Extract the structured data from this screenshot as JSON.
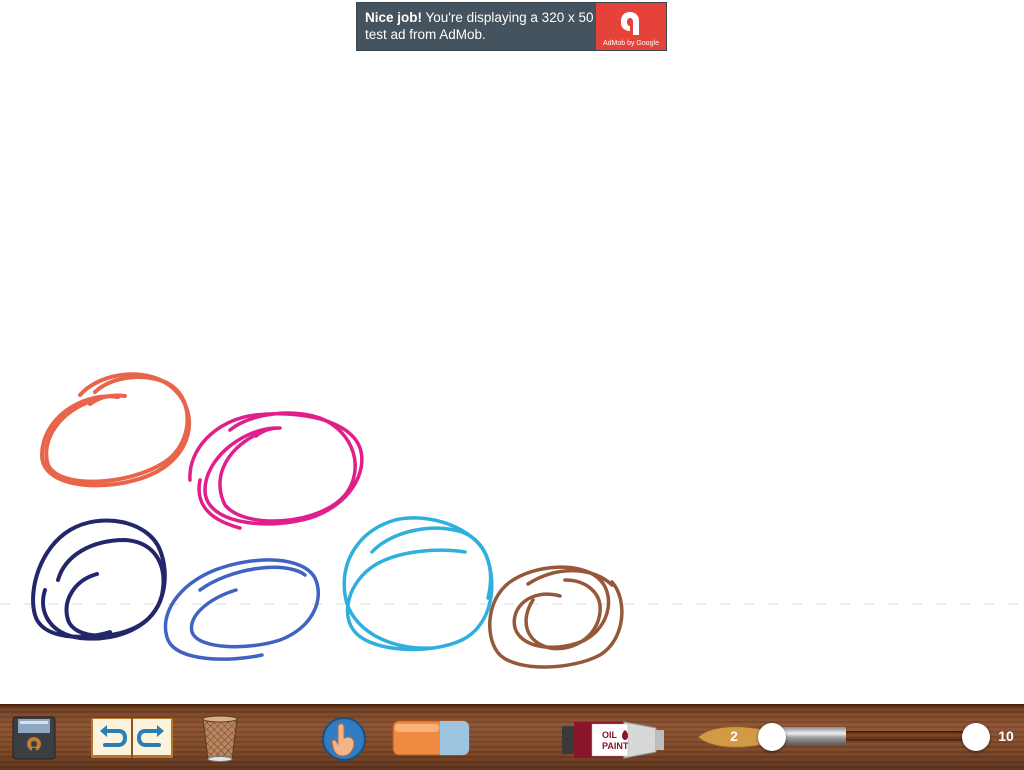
{
  "ad": {
    "bold": "Nice job!",
    "text": " You're displaying a 320 x 50 test ad from AdMob.",
    "logo_caption": "AdMob by Google",
    "bg_color": "#44535d",
    "logo_color": "#e5423a"
  },
  "drawing": {
    "strokes": [
      {
        "name": "orange-scribble",
        "color": "#e8644a"
      },
      {
        "name": "magenta-scribble",
        "color": "#e01e8c"
      },
      {
        "name": "navy-scribble",
        "color": "#23276a"
      },
      {
        "name": "blue-scribble",
        "color": "#3f62c4"
      },
      {
        "name": "cyan-scribble",
        "color": "#2fb0dc"
      },
      {
        "name": "brown-scribble",
        "color": "#96583a"
      }
    ]
  },
  "toolbar": {
    "tools": [
      "save-tool",
      "undo-tool",
      "redo-tool",
      "trash-tool",
      "finger-tool",
      "eraser-tool",
      "paint-tube-tool"
    ],
    "brush_size": {
      "value": "2",
      "max": "10"
    },
    "paint_label": "OIL PAINT"
  }
}
